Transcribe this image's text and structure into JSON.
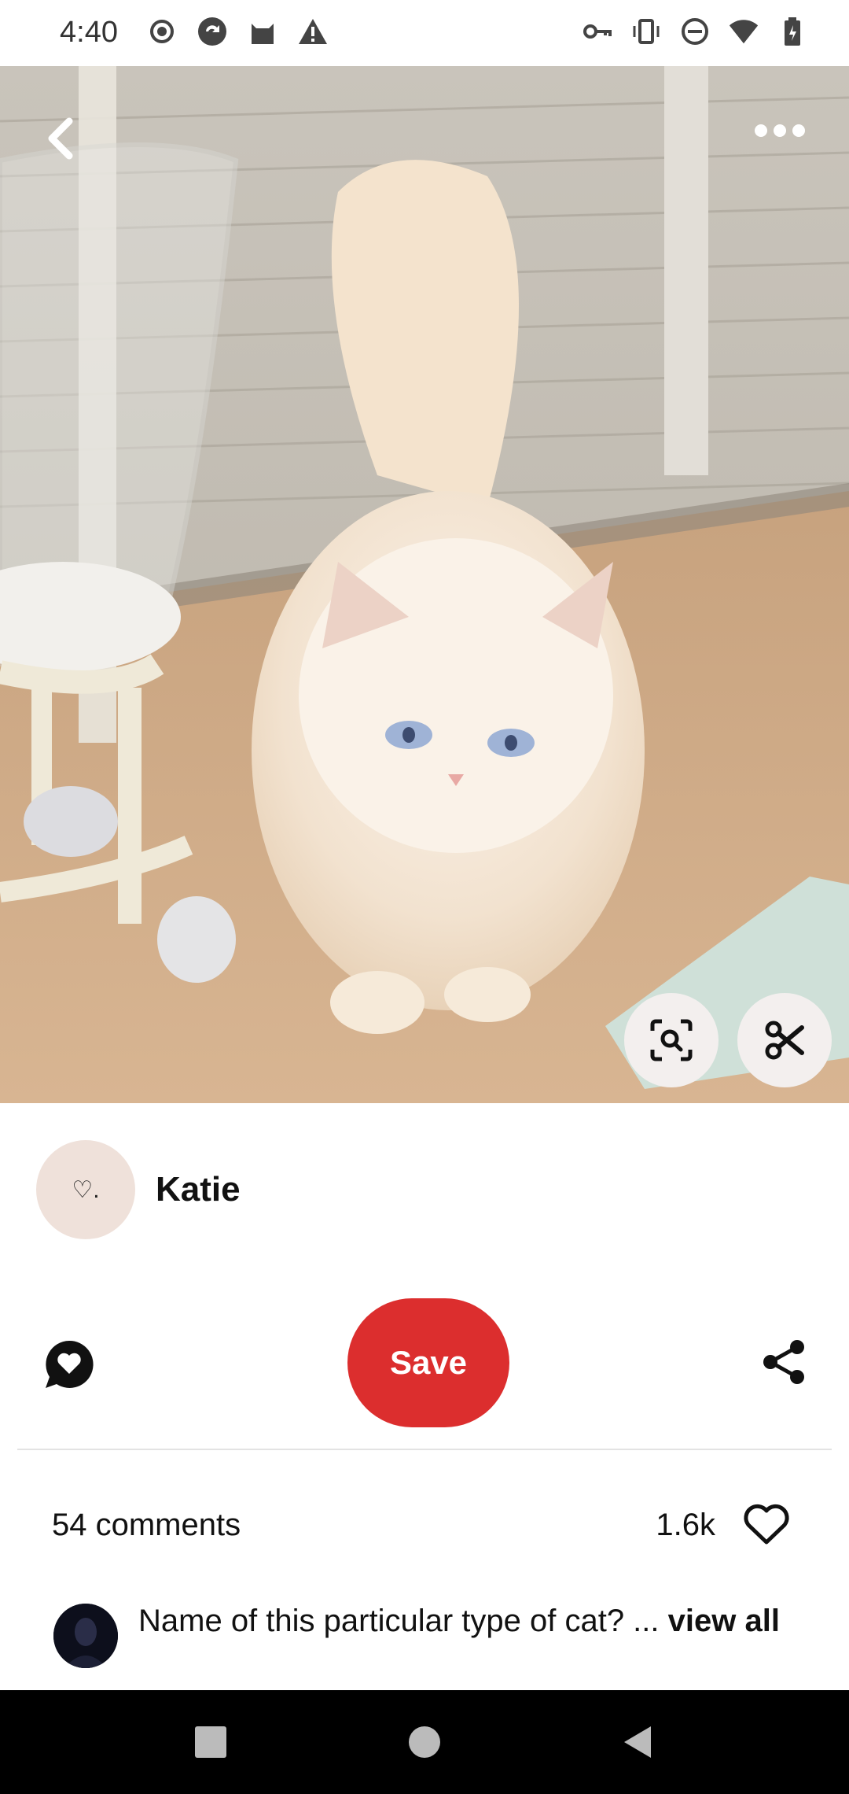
{
  "status_bar": {
    "time": "4:40",
    "left_icons": [
      "record-icon",
      "sync-icon",
      "cat-app-icon",
      "warning-icon"
    ],
    "right_icons": [
      "key-icon",
      "vibrate-icon",
      "dnd-icon",
      "wifi-icon",
      "battery-icon"
    ]
  },
  "pin": {
    "author": {
      "name": "Katie",
      "avatar_text": "♡."
    },
    "save_label": "Save",
    "comments_label": "54 comments",
    "likes_label": "1.6k"
  },
  "comment_preview": {
    "text": "Name of this particular type of cat? ... ",
    "link": "view all"
  },
  "icons": {
    "back": "chevron-left-icon",
    "more": "more-dots-icon",
    "lens": "visual-search-icon",
    "cut": "scissors-icon",
    "comment": "comment-heart-icon",
    "share": "share-icon",
    "like": "heart-outline-icon"
  },
  "colors": {
    "save": "#dc2e2e",
    "avatar_bg": "#efe1da",
    "nav_bg": "#000000"
  }
}
